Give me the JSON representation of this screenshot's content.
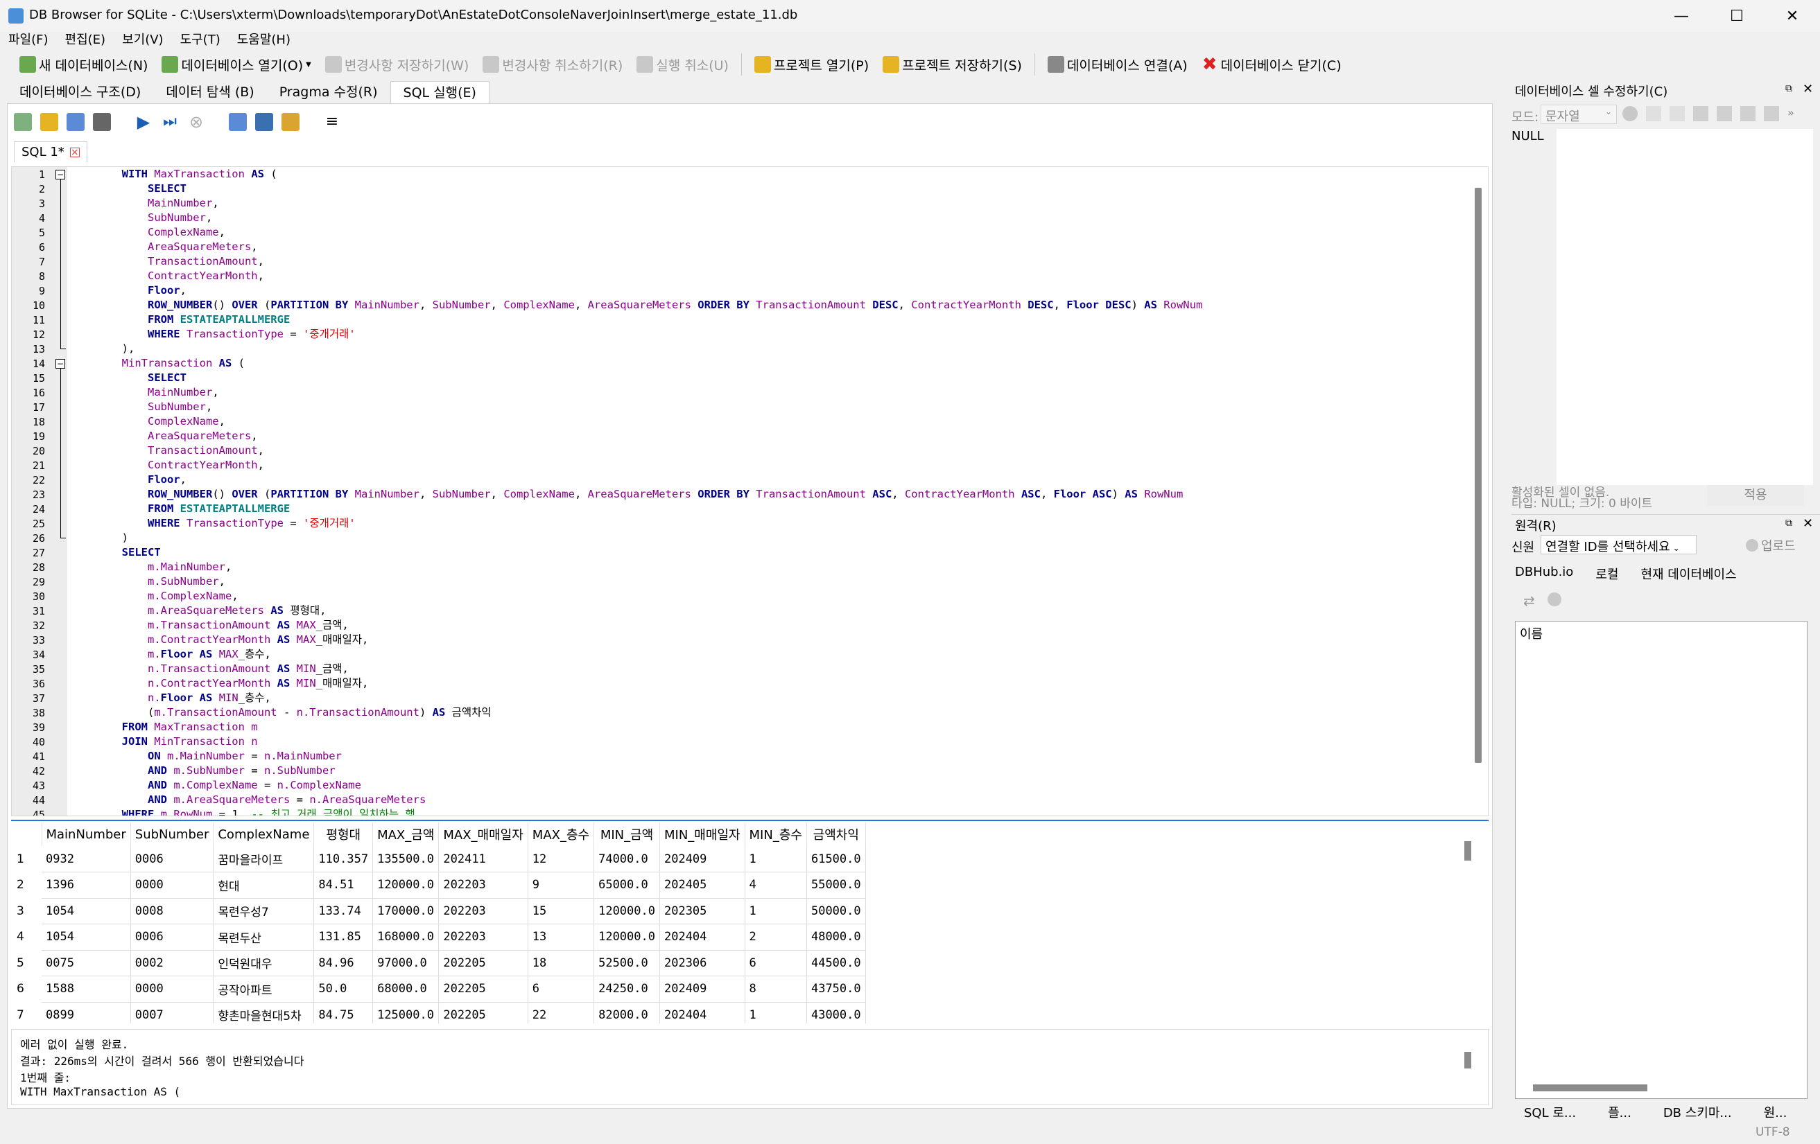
{
  "window": {
    "title": "DB Browser for SQLite - C:\\Users\\xterm\\Downloads\\temporaryDot\\AnEstateDotConsoleNaverJoinInsert\\merge_estate_11.db",
    "minimize": "—",
    "maximize": "☐",
    "close": "✕"
  },
  "menu": [
    "파일(F)",
    "편집(E)",
    "보기(V)",
    "도구(T)",
    "도움말(H)"
  ],
  "toolbar": {
    "new_db": "새 데이터베이스(N)",
    "open_db": "데이터베이스 열기(O)",
    "write_changes": "변경사항 저장하기(W)",
    "revert_changes": "변경사항 취소하기(R)",
    "undo": "실행 취소(U)",
    "open_project": "프로젝트 열기(P)",
    "save_project": "프로젝트 저장하기(S)",
    "attach_db": "데이터베이스 연결(A)",
    "close_db": "데이터베이스 닫기(C)"
  },
  "main_tabs": [
    "데이터베이스 구조(D)",
    "데이터 탐색 (B)",
    "Pragma 수정(R)",
    "SQL 실행(E)"
  ],
  "sql_tab": {
    "label": "SQL 1*"
  },
  "line_numbers": [
    "1",
    "2",
    "3",
    "4",
    "5",
    "6",
    "7",
    "8",
    "9",
    "10",
    "11",
    "12",
    "13",
    "14",
    "15",
    "16",
    "17",
    "18",
    "19",
    "20",
    "21",
    "22",
    "23",
    "24",
    "25",
    "26",
    "27",
    "28",
    "29",
    "30",
    "31",
    "32",
    "33",
    "34",
    "35",
    "36",
    "37",
    "38",
    "39",
    "40",
    "41",
    "42",
    "43",
    "44",
    "45"
  ],
  "code_lines": [
    [
      [
        "pl",
        "        "
      ],
      [
        "kw",
        "WITH"
      ],
      [
        "pl",
        " "
      ],
      [
        "id",
        "MaxTransaction"
      ],
      [
        "pl",
        " "
      ],
      [
        "kw",
        "AS"
      ],
      [
        "pl",
        " ("
      ]
    ],
    [
      [
        "pl",
        "            "
      ],
      [
        "kw",
        "SELECT"
      ]
    ],
    [
      [
        "pl",
        "            "
      ],
      [
        "id",
        "MainNumber"
      ],
      [
        "pl",
        ","
      ]
    ],
    [
      [
        "pl",
        "            "
      ],
      [
        "id",
        "SubNumber"
      ],
      [
        "pl",
        ","
      ]
    ],
    [
      [
        "pl",
        "            "
      ],
      [
        "id",
        "ComplexName"
      ],
      [
        "pl",
        ","
      ]
    ],
    [
      [
        "pl",
        "            "
      ],
      [
        "id",
        "AreaSquareMeters"
      ],
      [
        "pl",
        ","
      ]
    ],
    [
      [
        "pl",
        "            "
      ],
      [
        "id",
        "TransactionAmount"
      ],
      [
        "pl",
        ","
      ]
    ],
    [
      [
        "pl",
        "            "
      ],
      [
        "id",
        "ContractYearMonth"
      ],
      [
        "pl",
        ","
      ]
    ],
    [
      [
        "pl",
        "            "
      ],
      [
        "kw",
        "Floor"
      ],
      [
        "pl",
        ","
      ]
    ],
    [
      [
        "pl",
        "            "
      ],
      [
        "kw",
        "ROW_NUMBER"
      ],
      [
        "pl",
        "() "
      ],
      [
        "kw",
        "OVER"
      ],
      [
        "pl",
        " ("
      ],
      [
        "kw",
        "PARTITION BY"
      ],
      [
        "pl",
        " "
      ],
      [
        "id",
        "MainNumber"
      ],
      [
        "pl",
        ", "
      ],
      [
        "id",
        "SubNumber"
      ],
      [
        "pl",
        ", "
      ],
      [
        "id",
        "ComplexName"
      ],
      [
        "pl",
        ", "
      ],
      [
        "id",
        "AreaSquareMeters"
      ],
      [
        "pl",
        " "
      ],
      [
        "kw",
        "ORDER BY"
      ],
      [
        "pl",
        " "
      ],
      [
        "id",
        "TransactionAmount"
      ],
      [
        "pl",
        " "
      ],
      [
        "kw",
        "DESC"
      ],
      [
        "pl",
        ", "
      ],
      [
        "id",
        "ContractYearMonth"
      ],
      [
        "pl",
        " "
      ],
      [
        "kw",
        "DESC"
      ],
      [
        "pl",
        ", "
      ],
      [
        "kw",
        "Floor"
      ],
      [
        "pl",
        " "
      ],
      [
        "kw",
        "DESC"
      ],
      [
        "pl",
        ") "
      ],
      [
        "kw",
        "AS"
      ],
      [
        "pl",
        " "
      ],
      [
        "id",
        "RowNum"
      ]
    ],
    [
      [
        "pl",
        "            "
      ],
      [
        "kw",
        "FROM"
      ],
      [
        "pl",
        " "
      ],
      [
        "tb",
        "ESTATEAPTALLMERGE"
      ]
    ],
    [
      [
        "pl",
        "            "
      ],
      [
        "kw",
        "WHERE"
      ],
      [
        "pl",
        " "
      ],
      [
        "id",
        "TransactionType"
      ],
      [
        "pl",
        " = "
      ],
      [
        "st",
        "'중개거래'"
      ]
    ],
    [
      [
        "pl",
        "        ),"
      ]
    ],
    [
      [
        "pl",
        "        "
      ],
      [
        "id",
        "MinTransaction"
      ],
      [
        "pl",
        " "
      ],
      [
        "kw",
        "AS"
      ],
      [
        "pl",
        " ("
      ]
    ],
    [
      [
        "pl",
        "            "
      ],
      [
        "kw",
        "SELECT"
      ]
    ],
    [
      [
        "pl",
        "            "
      ],
      [
        "id",
        "MainNumber"
      ],
      [
        "pl",
        ","
      ]
    ],
    [
      [
        "pl",
        "            "
      ],
      [
        "id",
        "SubNumber"
      ],
      [
        "pl",
        ","
      ]
    ],
    [
      [
        "pl",
        "            "
      ],
      [
        "id",
        "ComplexName"
      ],
      [
        "pl",
        ","
      ]
    ],
    [
      [
        "pl",
        "            "
      ],
      [
        "id",
        "AreaSquareMeters"
      ],
      [
        "pl",
        ","
      ]
    ],
    [
      [
        "pl",
        "            "
      ],
      [
        "id",
        "TransactionAmount"
      ],
      [
        "pl",
        ","
      ]
    ],
    [
      [
        "pl",
        "            "
      ],
      [
        "id",
        "ContractYearMonth"
      ],
      [
        "pl",
        ","
      ]
    ],
    [
      [
        "pl",
        "            "
      ],
      [
        "kw",
        "Floor"
      ],
      [
        "pl",
        ","
      ]
    ],
    [
      [
        "pl",
        "            "
      ],
      [
        "kw",
        "ROW_NUMBER"
      ],
      [
        "pl",
        "() "
      ],
      [
        "kw",
        "OVER"
      ],
      [
        "pl",
        " ("
      ],
      [
        "kw",
        "PARTITION BY"
      ],
      [
        "pl",
        " "
      ],
      [
        "id",
        "MainNumber"
      ],
      [
        "pl",
        ", "
      ],
      [
        "id",
        "SubNumber"
      ],
      [
        "pl",
        ", "
      ],
      [
        "id",
        "ComplexName"
      ],
      [
        "pl",
        ", "
      ],
      [
        "id",
        "AreaSquareMeters"
      ],
      [
        "pl",
        " "
      ],
      [
        "kw",
        "ORDER BY"
      ],
      [
        "pl",
        " "
      ],
      [
        "id",
        "TransactionAmount"
      ],
      [
        "pl",
        " "
      ],
      [
        "kw",
        "ASC"
      ],
      [
        "pl",
        ", "
      ],
      [
        "id",
        "ContractYearMonth"
      ],
      [
        "pl",
        " "
      ],
      [
        "kw",
        "ASC"
      ],
      [
        "pl",
        ", "
      ],
      [
        "kw",
        "Floor"
      ],
      [
        "pl",
        " "
      ],
      [
        "kw",
        "ASC"
      ],
      [
        "pl",
        ") "
      ],
      [
        "kw",
        "AS"
      ],
      [
        "pl",
        " "
      ],
      [
        "id",
        "RowNum"
      ]
    ],
    [
      [
        "pl",
        "            "
      ],
      [
        "kw",
        "FROM"
      ],
      [
        "pl",
        " "
      ],
      [
        "tb",
        "ESTATEAPTALLMERGE"
      ]
    ],
    [
      [
        "pl",
        "            "
      ],
      [
        "kw",
        "WHERE"
      ],
      [
        "pl",
        " "
      ],
      [
        "id",
        "TransactionType"
      ],
      [
        "pl",
        " = "
      ],
      [
        "st",
        "'중개거래'"
      ]
    ],
    [
      [
        "pl",
        "        )"
      ]
    ],
    [
      [
        "pl",
        "        "
      ],
      [
        "kw",
        "SELECT"
      ]
    ],
    [
      [
        "pl",
        "            "
      ],
      [
        "id",
        "m.MainNumber"
      ],
      [
        "pl",
        ","
      ]
    ],
    [
      [
        "pl",
        "            "
      ],
      [
        "id",
        "m.SubNumber"
      ],
      [
        "pl",
        ","
      ]
    ],
    [
      [
        "pl",
        "            "
      ],
      [
        "id",
        "m.ComplexName"
      ],
      [
        "pl",
        ","
      ]
    ],
    [
      [
        "pl",
        "            "
      ],
      [
        "id",
        "m.AreaSquareMeters"
      ],
      [
        "pl",
        " "
      ],
      [
        "kw",
        "AS"
      ],
      [
        "pl",
        " 평형대,"
      ]
    ],
    [
      [
        "pl",
        "            "
      ],
      [
        "id",
        "m.TransactionAmount"
      ],
      [
        "pl",
        " "
      ],
      [
        "kw",
        "AS"
      ],
      [
        "pl",
        " "
      ],
      [
        "id",
        "MAX"
      ],
      [
        "pl",
        "_금액,"
      ]
    ],
    [
      [
        "pl",
        "            "
      ],
      [
        "id",
        "m.ContractYearMonth"
      ],
      [
        "pl",
        " "
      ],
      [
        "kw",
        "AS"
      ],
      [
        "pl",
        " "
      ],
      [
        "id",
        "MAX"
      ],
      [
        "pl",
        "_매매일자,"
      ]
    ],
    [
      [
        "pl",
        "            "
      ],
      [
        "id",
        "m."
      ],
      [
        "kw",
        "Floor"
      ],
      [
        "pl",
        " "
      ],
      [
        "kw",
        "AS"
      ],
      [
        "pl",
        " "
      ],
      [
        "id",
        "MAX"
      ],
      [
        "pl",
        "_층수,"
      ]
    ],
    [
      [
        "pl",
        "            "
      ],
      [
        "id",
        "n.TransactionAmount"
      ],
      [
        "pl",
        " "
      ],
      [
        "kw",
        "AS"
      ],
      [
        "pl",
        " "
      ],
      [
        "id",
        "MIN"
      ],
      [
        "pl",
        "_금액,"
      ]
    ],
    [
      [
        "pl",
        "            "
      ],
      [
        "id",
        "n.ContractYearMonth"
      ],
      [
        "pl",
        " "
      ],
      [
        "kw",
        "AS"
      ],
      [
        "pl",
        " "
      ],
      [
        "id",
        "MIN"
      ],
      [
        "pl",
        "_매매일자,"
      ]
    ],
    [
      [
        "pl",
        "            "
      ],
      [
        "id",
        "n."
      ],
      [
        "kw",
        "Floor"
      ],
      [
        "pl",
        " "
      ],
      [
        "kw",
        "AS"
      ],
      [
        "pl",
        " "
      ],
      [
        "id",
        "MIN"
      ],
      [
        "pl",
        "_층수,"
      ]
    ],
    [
      [
        "pl",
        "            ("
      ],
      [
        "id",
        "m.TransactionAmount"
      ],
      [
        "pl",
        " - "
      ],
      [
        "id",
        "n.TransactionAmount"
      ],
      [
        "pl",
        ") "
      ],
      [
        "kw",
        "AS"
      ],
      [
        "pl",
        " 금액차익"
      ]
    ],
    [
      [
        "pl",
        "        "
      ],
      [
        "kw",
        "FROM"
      ],
      [
        "pl",
        " "
      ],
      [
        "id",
        "MaxTransaction m"
      ]
    ],
    [
      [
        "pl",
        "        "
      ],
      [
        "kw",
        "JOIN"
      ],
      [
        "pl",
        " "
      ],
      [
        "id",
        "MinTransaction n"
      ]
    ],
    [
      [
        "pl",
        "            "
      ],
      [
        "kw",
        "ON"
      ],
      [
        "pl",
        " "
      ],
      [
        "id",
        "m.MainNumber"
      ],
      [
        "pl",
        " = "
      ],
      [
        "id",
        "n.MainNumber"
      ]
    ],
    [
      [
        "pl",
        "            "
      ],
      [
        "kw",
        "AND"
      ],
      [
        "pl",
        " "
      ],
      [
        "id",
        "m.SubNumber"
      ],
      [
        "pl",
        " = "
      ],
      [
        "id",
        "n.SubNumber"
      ]
    ],
    [
      [
        "pl",
        "            "
      ],
      [
        "kw",
        "AND"
      ],
      [
        "pl",
        " "
      ],
      [
        "id",
        "m.ComplexName"
      ],
      [
        "pl",
        " = "
      ],
      [
        "id",
        "n.ComplexName"
      ]
    ],
    [
      [
        "pl",
        "            "
      ],
      [
        "kw",
        "AND"
      ],
      [
        "pl",
        " "
      ],
      [
        "id",
        "m.AreaSquareMeters"
      ],
      [
        "pl",
        " = "
      ],
      [
        "id",
        "n.AreaSquareMeters"
      ]
    ],
    [
      [
        "pl",
        "        "
      ],
      [
        "kw",
        "WHERE"
      ],
      [
        "pl",
        " "
      ],
      [
        "id",
        "m.RowNum"
      ],
      [
        "pl",
        " = 1  "
      ],
      [
        "cm",
        "-- 최고 거래 금액이 일치하는 행"
      ]
    ]
  ],
  "results": {
    "columns": [
      "MainNumber",
      "SubNumber",
      "ComplexName",
      "평형대",
      "MAX_금액",
      "MAX_매매일자",
      "MAX_층수",
      "MIN_금액",
      "MIN_매매일자",
      "MIN_층수",
      "금액차익"
    ],
    "rows": [
      [
        "1",
        "0932",
        "0006",
        "꿈마을라이프",
        "110.357",
        "135500.0",
        "202411",
        "12",
        "74000.0",
        "202409",
        "1",
        "61500.0"
      ],
      [
        "2",
        "1396",
        "0000",
        "현대",
        "84.51",
        "120000.0",
        "202203",
        "9",
        "65000.0",
        "202405",
        "4",
        "55000.0"
      ],
      [
        "3",
        "1054",
        "0008",
        "목련우성7",
        "133.74",
        "170000.0",
        "202203",
        "15",
        "120000.0",
        "202305",
        "1",
        "50000.0"
      ],
      [
        "4",
        "1054",
        "0006",
        "목련두산",
        "131.85",
        "168000.0",
        "202203",
        "13",
        "120000.0",
        "202404",
        "2",
        "48000.0"
      ],
      [
        "5",
        "0075",
        "0002",
        "인덕원대우",
        "84.96",
        "97000.0",
        "202205",
        "18",
        "52500.0",
        "202306",
        "6",
        "44500.0"
      ],
      [
        "6",
        "1588",
        "0000",
        "공작아파트",
        "50.0",
        "68000.0",
        "202205",
        "6",
        "24250.0",
        "202409",
        "8",
        "43750.0"
      ],
      [
        "7",
        "0899",
        "0007",
        "향촌마을현대5차",
        "84.75",
        "125000.0",
        "202205",
        "22",
        "82000.0",
        "202404",
        "1",
        "43000.0"
      ]
    ]
  },
  "messages": {
    "line1": "에러 없이 실행 완료.",
    "line2": "결과: 226ms의 시간이 걸려서 566 행이 반환되었습니다",
    "line3": "1번째 줄:",
    "line4": "WITH MaxTransaction AS ("
  },
  "cell_editor": {
    "title": "데이터베이스 셀 수정하기(C)",
    "mode_label": "모드:",
    "mode_value": "문자열",
    "value": "NULL",
    "status1": "활성화된 셀이 없음.",
    "status2": "타입: NULL; 크기: 0 바이트",
    "apply": "적용"
  },
  "remote": {
    "title": "원격(R)",
    "identity_label": "신원",
    "identity_value": "연결할 ID를 선택하세요",
    "upload": "업로드",
    "tabs": [
      "DBHub.io",
      "로컬",
      "현재 데이터베이스"
    ],
    "list_header": "이름"
  },
  "bottom_tabs": [
    "SQL 로...",
    "플...",
    "DB 스키마...",
    "원..."
  ],
  "status": {
    "encoding": "UTF-8"
  }
}
